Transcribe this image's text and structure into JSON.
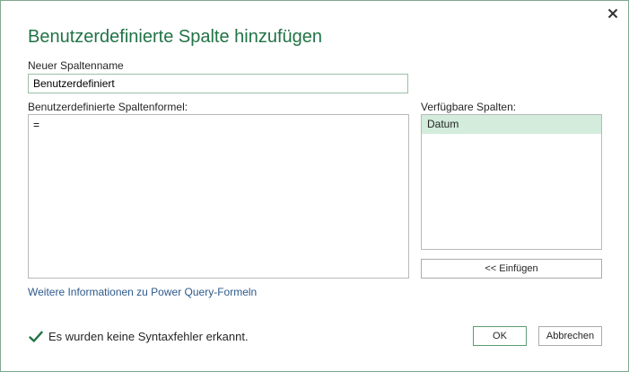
{
  "dialog": {
    "title": "Benutzerdefinierte Spalte hinzufügen",
    "close_icon": "close-icon"
  },
  "column_name": {
    "label": "Neuer Spaltenname",
    "value": "Benutzerdefiniert"
  },
  "formula": {
    "label": "Benutzerdefinierte Spaltenformel:",
    "value": "="
  },
  "available_columns": {
    "label": "Verfügbare Spalten:",
    "items": [
      {
        "label": "Datum",
        "selected": true
      }
    ],
    "insert_label": "<< Einfügen"
  },
  "help_link": "Weitere Informationen zu Power Query-Formeln",
  "status": {
    "icon": "checkmark-icon",
    "text": "Es wurden keine Syntaxfehler erkannt.",
    "color": "#217346"
  },
  "buttons": {
    "ok_label": "OK",
    "cancel_label": "Abbrechen"
  },
  "colors": {
    "accent": "#217346",
    "selection": "#d3ecdc",
    "link": "#2e5a8c"
  }
}
